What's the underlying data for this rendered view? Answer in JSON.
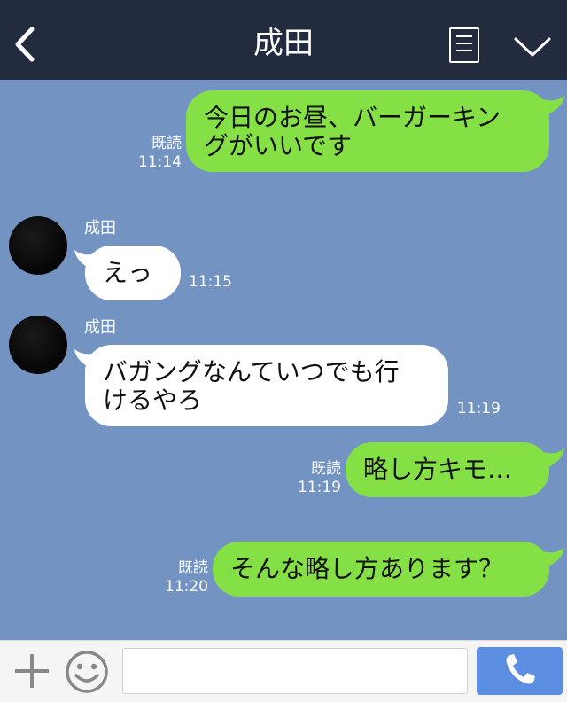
{
  "header": {
    "title": "成田",
    "back_icon": "chevron-left-icon",
    "notes_icon": "notes-icon",
    "menu_icon": "chevron-down-icon"
  },
  "messages": [
    {
      "from": "me",
      "text_line1": "今日のお昼、バーガーキン",
      "text_line2": "グがいいです",
      "read": "既読",
      "time": "11:14"
    },
    {
      "from": "them",
      "sender": "成田",
      "text": "えっ",
      "time": "11:15"
    },
    {
      "from": "them",
      "sender": "成田",
      "text_line1": "バガングなんていつでも行",
      "text_line2": "けるやろ",
      "time": "11:19"
    },
    {
      "from": "me",
      "text": "略し方キモ…",
      "read": "既読",
      "time": "11:19"
    },
    {
      "from": "me",
      "text": "そんな略し方あります？",
      "read": "既読",
      "time": "11:20"
    }
  ],
  "footer": {
    "input_value": "",
    "plus_icon": "plus-icon",
    "emoji_icon": "smiley-icon",
    "call_icon": "phone-icon"
  },
  "colors": {
    "header_bg": "#232c3f",
    "chat_bg": "#7393c3",
    "my_bubble": "#84e045",
    "their_bubble": "#ffffff",
    "call_button": "#5b8de0"
  }
}
